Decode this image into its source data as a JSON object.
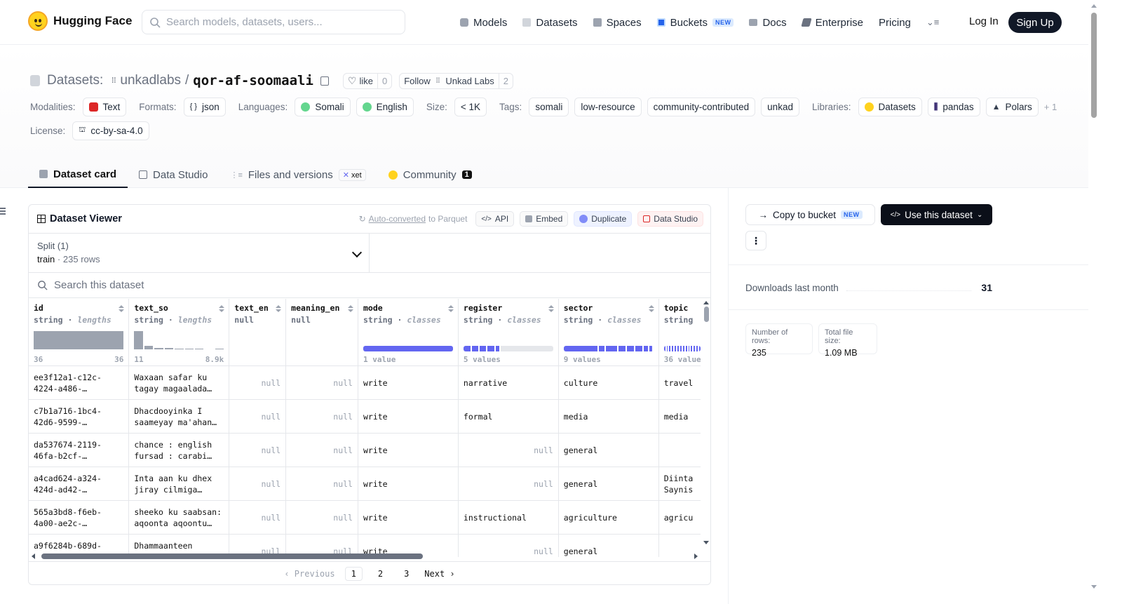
{
  "nav": {
    "brand": "Hugging Face",
    "search_placeholder": "Search models, datasets, users...",
    "links": [
      {
        "label": "Models",
        "icon": "models-icon",
        "color": "#9ca3af"
      },
      {
        "label": "Datasets",
        "icon": "datasets-icon",
        "color": "#d1d5db"
      },
      {
        "label": "Spaces",
        "icon": "spaces-icon",
        "color": "#9ca3af"
      },
      {
        "label": "Buckets",
        "icon": "buckets-icon",
        "color": "#2563eb",
        "badge": "NEW"
      },
      {
        "label": "Docs",
        "icon": "docs-icon",
        "color": "#9ca3af"
      },
      {
        "label": "Enterprise",
        "icon": "enterprise-icon",
        "color": "#6b7280"
      },
      {
        "label": "Pricing"
      }
    ],
    "menu_icon": "more-menu-icon",
    "login": "Log In",
    "signup": "Sign Up"
  },
  "header": {
    "prefix": "Datasets:",
    "org": "unkadlabs",
    "separator": "/",
    "name": "qor-af-soomaali",
    "like_label": "like",
    "like_count": "0",
    "follow_label": "Follow",
    "follow_org": "Unkad Labs",
    "follow_count": "2",
    "modalities_label": "Modalities:",
    "modality": "Text",
    "formats_label": "Formats:",
    "format": "json",
    "languages_label": "Languages:",
    "languages": [
      "Somali",
      "English"
    ],
    "size_label": "Size:",
    "size": "< 1K",
    "tags_label": "Tags:",
    "tags": [
      "somali",
      "low-resource",
      "community-contributed",
      "unkad"
    ],
    "libraries_label": "Libraries:",
    "libraries": [
      "Datasets",
      "pandas",
      "Polars"
    ],
    "libraries_more": "+ 1",
    "license_label": "License:",
    "license": "cc-by-sa-4.0"
  },
  "tabs": [
    {
      "label": "Dataset card",
      "active": true
    },
    {
      "label": "Data Studio"
    },
    {
      "label": "Files and versions",
      "badge": "xet"
    },
    {
      "label": "Community",
      "count": "1"
    }
  ],
  "viewer": {
    "title": "Dataset Viewer",
    "auto_converted": "Auto-converted",
    "to_parquet": "to Parquet",
    "buttons": [
      "API",
      "Embed",
      "Duplicate",
      "Data Studio"
    ],
    "split_label": "Split (1)",
    "split_name": "train",
    "split_sep": "·",
    "split_rows": "235 rows",
    "search_placeholder": "Search this dataset",
    "columns": [
      {
        "name": "id",
        "type": "string",
        "stat": "lengths",
        "min": "36",
        "max": "36"
      },
      {
        "name": "text_so",
        "type": "string",
        "stat": "lengths",
        "min": "11",
        "max": "8.9k"
      },
      {
        "name": "text_en",
        "type": "null"
      },
      {
        "name": "meaning_en",
        "type": "null"
      },
      {
        "name": "mode",
        "type": "string",
        "stat": "classes",
        "values": "1 value"
      },
      {
        "name": "register",
        "type": "string",
        "stat": "classes",
        "values": "5 values"
      },
      {
        "name": "sector",
        "type": "string",
        "stat": "classes",
        "values": "9 values"
      },
      {
        "name": "topic",
        "type": "string",
        "stat": "classes",
        "values": "36 values"
      }
    ],
    "rows": [
      {
        "id": "ee3f12a1-c12c-4224-a486-…",
        "text_so": "Waxaan safar ku tagay magaalada…",
        "text_en": "null",
        "meaning_en": "null",
        "mode": "write",
        "register": "narrative",
        "sector": "culture",
        "topic": "travel"
      },
      {
        "id": "c7b1a716-1bc4-42d6-9599-…",
        "text_so": "Dhacdooyinka I saameyay ma'ahan…",
        "text_en": "null",
        "meaning_en": "null",
        "mode": "write",
        "register": "formal",
        "sector": "media",
        "topic": "media"
      },
      {
        "id": "da537674-2119-46fa-b2cf-…",
        "text_so": "chance : english fursad : carabi…",
        "text_en": "null",
        "meaning_en": "null",
        "mode": "write",
        "register": "null",
        "sector": "general",
        "topic": ""
      },
      {
        "id": "a4cad624-a324-424d-ad42-…",
        "text_so": "Inta aan ku dhex jiray cilmiga…",
        "text_en": "null",
        "meaning_en": "null",
        "mode": "write",
        "register": "null",
        "sector": "general",
        "topic": "Diinta Saynis"
      },
      {
        "id": "565a3bd8-f6eb-4a00-ae2c-…",
        "text_so": "sheeko ku saabsan: aqoonta aqoontu…",
        "text_en": "null",
        "meaning_en": "null",
        "mode": "write",
        "register": "instructional",
        "sector": "agriculture",
        "topic": "agricu"
      },
      {
        "id": "a9f6284b-689d-",
        "text_so": "Dhammaanteen",
        "text_en": "null",
        "meaning_en": "null",
        "mode": "write",
        "register": "null",
        "sector": "general",
        "topic": ""
      }
    ],
    "pager": {
      "prev": "Previous",
      "pages": [
        "1",
        "2",
        "3"
      ],
      "current": "1",
      "next": "Next"
    }
  },
  "sidebar": {
    "copy_label": "Copy to bucket",
    "copy_badge": "NEW",
    "use_label": "Use this dataset",
    "more_icon": "kebab-icon",
    "downloads_label": "Downloads last month",
    "downloads_value": "31",
    "rows_label": "Number of rows:",
    "rows_value": "235",
    "size_label": "Total file size:",
    "size_value": "1.09 MB"
  }
}
